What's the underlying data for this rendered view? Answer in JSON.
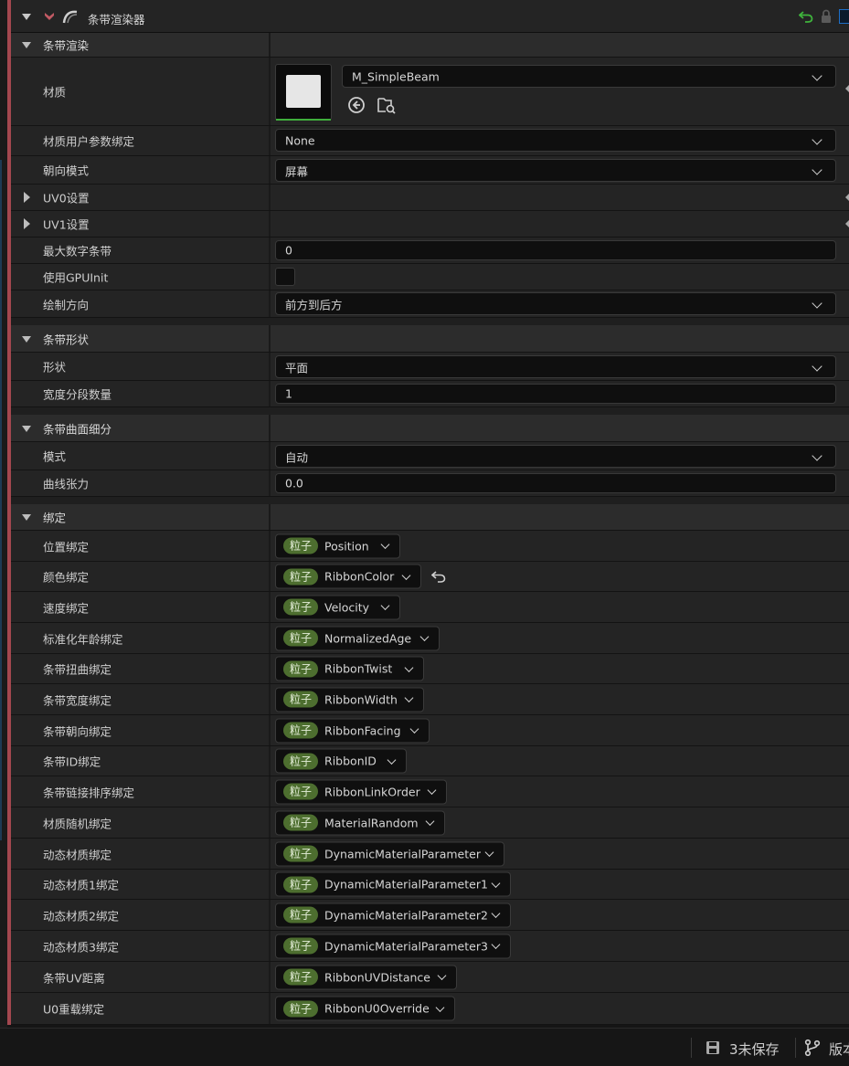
{
  "header": {
    "title": "条带渲染器",
    "accent_color": "#a3474f",
    "reset_color": "#3fb43c"
  },
  "render": {
    "category": "条带渲染",
    "material_label": "材质",
    "material_value": "M_SimpleBeam",
    "mat_user_param_label": "材质用户参数绑定",
    "mat_user_param_value": "None",
    "facing_label": "朝向模式",
    "facing_value": "屏幕",
    "uv0_label": "UV0设置",
    "uv1_label": "UV1设置",
    "max_ribbons_label": "最大数字条带",
    "max_ribbons_value": "0",
    "gpu_init_label": "使用GPUInit",
    "draw_dir_label": "绘制方向",
    "draw_dir_value": "前方到后方"
  },
  "shape": {
    "category": "条带形状",
    "shape_label": "形状",
    "shape_value": "平面",
    "width_segments_label": "宽度分段数量",
    "width_segments_value": "1"
  },
  "tess": {
    "category": "条带曲面细分",
    "mode_label": "模式",
    "mode_value": "自动",
    "curve_label": "曲线张力",
    "curve_value": "0.0"
  },
  "bindings": {
    "category": "绑定",
    "tag": "粒子",
    "items": [
      {
        "label": "位置绑定",
        "value": "Position"
      },
      {
        "label": "颜色绑定",
        "value": "RibbonColor"
      },
      {
        "label": "速度绑定",
        "value": "Velocity"
      },
      {
        "label": "标准化年龄绑定",
        "value": "NormalizedAge"
      },
      {
        "label": "条带扭曲绑定",
        "value": "RibbonTwist"
      },
      {
        "label": "条带宽度绑定",
        "value": "RibbonWidth"
      },
      {
        "label": "条带朝向绑定",
        "value": "RibbonFacing"
      },
      {
        "label": "条带ID绑定",
        "value": "RibbonID"
      },
      {
        "label": "条带链接排序绑定",
        "value": "RibbonLinkOrder"
      },
      {
        "label": "材质随机绑定",
        "value": "MaterialRandom"
      },
      {
        "label": "动态材质绑定",
        "value": "DynamicMaterialParameter"
      },
      {
        "label": "动态材质1绑定",
        "value": "DynamicMaterialParameter1"
      },
      {
        "label": "动态材质2绑定",
        "value": "DynamicMaterialParameter2"
      },
      {
        "label": "动态材质3绑定",
        "value": "DynamicMaterialParameter3"
      },
      {
        "label": "条带UV距离",
        "value": "RibbonUVDistance"
      },
      {
        "label": "U0重载绑定",
        "value": "RibbonU0Override"
      }
    ]
  },
  "status": {
    "unsaved": "3未保存",
    "version": "版本控制"
  }
}
